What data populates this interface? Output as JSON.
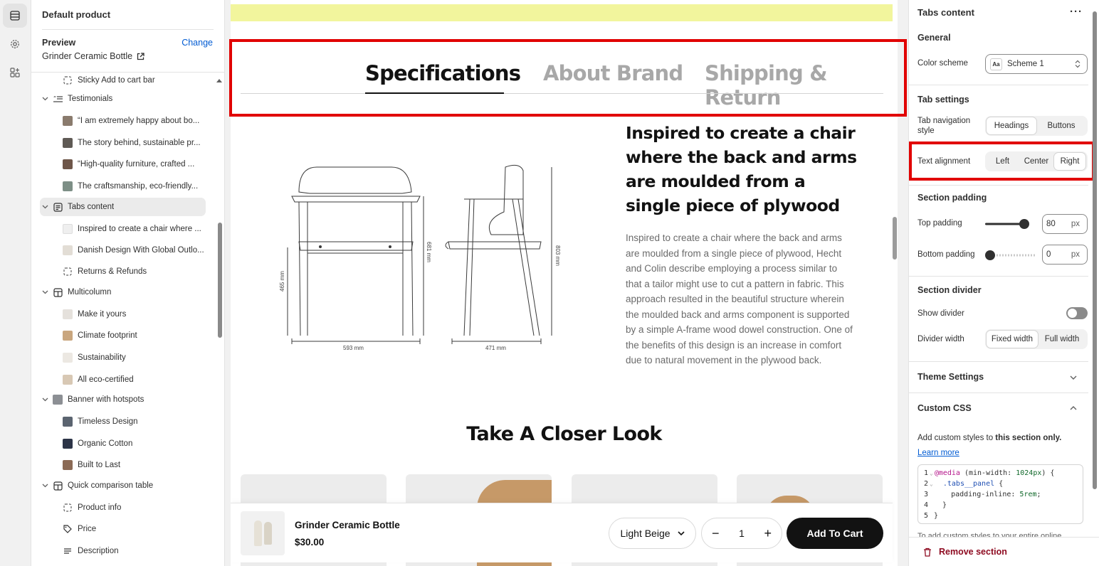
{
  "sidebar": {
    "title": "Default product",
    "preview_label": "Preview",
    "change_link": "Change",
    "preview_product": "Grinder Ceramic Bottle",
    "tree": [
      {
        "label": "Sticky Add to cart bar",
        "kind": "block",
        "icon": "dashed-square-icon"
      },
      {
        "label": "Testimonials",
        "kind": "section",
        "icon": "quote-list-icon"
      },
      {
        "label": "“I am extremely happy about bo...",
        "kind": "block",
        "icon": "avatar-thumb"
      },
      {
        "label": "The story behind, sustainable pr...",
        "kind": "block",
        "icon": "avatar-thumb"
      },
      {
        "label": "“High-quality furniture, crafted ...",
        "kind": "block",
        "icon": "avatar-thumb"
      },
      {
        "label": "The craftsmanship, eco-friendly...",
        "kind": "block",
        "icon": "avatar-thumb"
      },
      {
        "label": "Tabs content",
        "kind": "section-selected",
        "icon": "tabs-icon"
      },
      {
        "label": "Inspired to create a chair where ...",
        "kind": "block",
        "icon": "image-thumb"
      },
      {
        "label": "Danish Design With Global Outlo...",
        "kind": "block",
        "icon": "image-thumb"
      },
      {
        "label": "Returns & Refunds",
        "kind": "block",
        "icon": "dashed-square-icon"
      },
      {
        "label": "Multicolumn",
        "kind": "section",
        "icon": "columns-icon"
      },
      {
        "label": "Make it yours",
        "kind": "block",
        "icon": "image-thumb"
      },
      {
        "label": "Climate footprint",
        "kind": "block",
        "icon": "image-thumb"
      },
      {
        "label": "Sustainability",
        "kind": "block",
        "icon": "image-thumb"
      },
      {
        "label": "All eco-certified",
        "kind": "block",
        "icon": "image-thumb"
      },
      {
        "label": "Banner with hotspots",
        "kind": "section",
        "icon": "banner-thumb"
      },
      {
        "label": "Timeless Design",
        "kind": "block",
        "icon": "image-thumb"
      },
      {
        "label": "Organic Cotton",
        "kind": "block",
        "icon": "image-thumb"
      },
      {
        "label": "Built to Last",
        "kind": "block",
        "icon": "image-thumb"
      },
      {
        "label": "Quick comparison table",
        "kind": "section",
        "icon": "columns-icon"
      },
      {
        "label": "Product info",
        "kind": "block",
        "icon": "dashed-square-icon"
      },
      {
        "label": "Price",
        "kind": "block",
        "icon": "price-tag-icon"
      },
      {
        "label": "Description",
        "kind": "block",
        "icon": "text-lines-icon"
      }
    ]
  },
  "preview": {
    "tabs": [
      "Specifications",
      "About Brand",
      "Shipping & Return"
    ],
    "active_tab": 0,
    "drawing": {
      "dim_width_front": "593 mm",
      "dim_width_side": "471 mm",
      "dim_seat_height": "465 mm",
      "dim_arm_height": "681 mm",
      "dim_total_height": "803 mm"
    },
    "heading": "Inspired to create a chair where the back and arms are moulded from a single piece of plywood",
    "body": "Inspired to create a chair where the back and arms are moulded from a single piece of plywood, Hecht and Colin describe employing a process similar to that a tailor might use to cut a pattern in fabric. This approach resulted in the beautiful structure wherein the moulded back and arms component is supported by a simple A-frame wood dowel construction. One of the benefits of this design is an increase in comfort due to natural movement in the plywood back.",
    "closer_title": "Take A Closer Look"
  },
  "sticky_bar": {
    "product_name": "Grinder Ceramic Bottle",
    "price": "$30.00",
    "variant": "Light Beige",
    "quantity": "1",
    "add_to_cart": "Add To Cart"
  },
  "settings": {
    "title": "Tabs content",
    "general": {
      "heading": "General",
      "color_scheme_label": "Color scheme",
      "color_scheme_value": "Scheme 1",
      "swatch_text": "Aa"
    },
    "tab_settings": {
      "heading": "Tab settings",
      "nav_style_label": "Tab navigation style",
      "nav_style_options": [
        "Headings",
        "Buttons"
      ],
      "nav_style_selected": "Headings",
      "alignment_label": "Text alignment",
      "alignment_options": [
        "Left",
        "Center",
        "Right"
      ],
      "alignment_selected": "Right"
    },
    "section_padding": {
      "heading": "Section padding",
      "top_label": "Top padding",
      "top_value": "80",
      "bottom_label": "Bottom padding",
      "bottom_value": "0",
      "unit": "px"
    },
    "section_divider": {
      "heading": "Section divider",
      "show_label": "Show divider",
      "show_value": false,
      "width_label": "Divider width",
      "width_options": [
        "Fixed width",
        "Full width"
      ],
      "width_selected": "Fixed width"
    },
    "theme_settings": "Theme Settings",
    "custom_css": {
      "heading": "Custom CSS",
      "help_prefix": "Add custom styles to ",
      "help_bold": "this section only.",
      "learn_more": "Learn more",
      "code_lines": [
        "@media (min-width: 1024px) {",
        "  .tabs__panel {",
        "    padding-inline: 5rem;",
        "  }",
        "}"
      ],
      "footer_cut": "To add custom styles to your entire online"
    },
    "remove_section": "Remove section"
  },
  "colors": {
    "accent_link": "#005bd3",
    "highlight_box": "#e10000",
    "announcement_bar": "#f2f59d",
    "danger": "#8e0b21"
  }
}
